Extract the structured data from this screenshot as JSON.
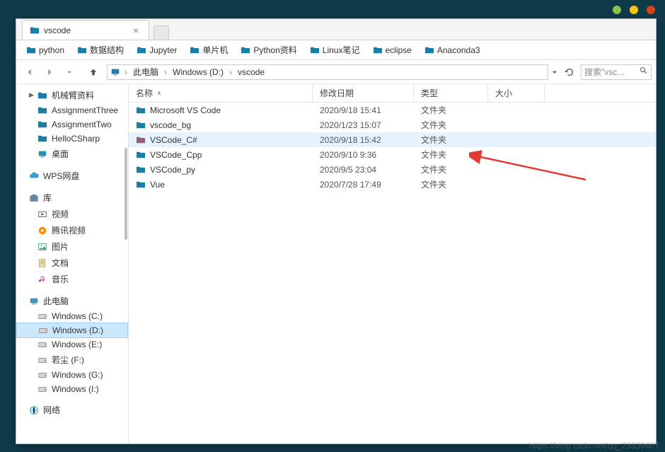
{
  "titlebar": {
    "dots": [
      "green",
      "yellow",
      "red"
    ]
  },
  "tab": {
    "title": "vscode"
  },
  "bookmarks": [
    {
      "label": "python"
    },
    {
      "label": "数据结构"
    },
    {
      "label": "Jupyter"
    },
    {
      "label": "单片机"
    },
    {
      "label": "Python资料"
    },
    {
      "label": "Linux笔记"
    },
    {
      "label": "eclipse"
    },
    {
      "label": "Anaconda3"
    }
  ],
  "breadcrumb": {
    "parts": [
      "此电脑",
      "Windows (D:)",
      "vscode"
    ]
  },
  "search": {
    "placeholder": "搜索\"vsc..."
  },
  "sidebar": {
    "top": [
      {
        "label": "机械臂资料",
        "icon": "folder-teal",
        "chev": true
      },
      {
        "label": "AssignmentThree",
        "icon": "folder-teal"
      },
      {
        "label": "AssignmentTwo",
        "icon": "folder-teal"
      },
      {
        "label": "HelloCSharp",
        "icon": "folder-teal"
      },
      {
        "label": "桌面",
        "icon": "desktop"
      }
    ],
    "wps": {
      "label": "WPS网盘",
      "icon": "cloud"
    },
    "lib": {
      "label": "库",
      "icon": "library",
      "items": [
        {
          "label": "视频",
          "icon": "video"
        },
        {
          "label": "腾讯视频",
          "icon": "qqvideo"
        },
        {
          "label": "图片",
          "icon": "pictures"
        },
        {
          "label": "文档",
          "icon": "documents"
        },
        {
          "label": "音乐",
          "icon": "music"
        }
      ]
    },
    "pc": {
      "label": "此电脑",
      "icon": "pc",
      "drives": [
        {
          "label": "Windows (C:)"
        },
        {
          "label": "Windows (D:)",
          "selected": true
        },
        {
          "label": "Windows (E:)"
        },
        {
          "label": "若尘 (F:)"
        },
        {
          "label": "Windows (G:)"
        },
        {
          "label": "Windows (I:)"
        }
      ]
    },
    "network": {
      "label": "网络"
    }
  },
  "columns": {
    "name": "名称",
    "date": "修改日期",
    "type": "类型",
    "size": "大小"
  },
  "files": [
    {
      "name": "Microsoft VS Code",
      "date": "2020/9/18 15:41",
      "type": "文件夹",
      "color": "#1a7fa4"
    },
    {
      "name": "vscode_bg",
      "date": "2020/1/23 15:07",
      "type": "文件夹",
      "color": "#1a7fa4"
    },
    {
      "name": "VSCode_C#",
      "date": "2020/9/18 15:42",
      "type": "文件夹",
      "color": "#9c5a78",
      "selected": true
    },
    {
      "name": "VSCode_Cpp",
      "date": "2020/9/10 9:36",
      "type": "文件夹",
      "color": "#1a7fa4"
    },
    {
      "name": "VSCode_py",
      "date": "2020/9/5 23:04",
      "type": "文件夹",
      "color": "#1a7fa4"
    },
    {
      "name": "Vue",
      "date": "2020/7/28 17:49",
      "type": "文件夹",
      "color": "#1a7fa4"
    }
  ],
  "watermark": "https://blog.csdn.net/qq_29339467"
}
